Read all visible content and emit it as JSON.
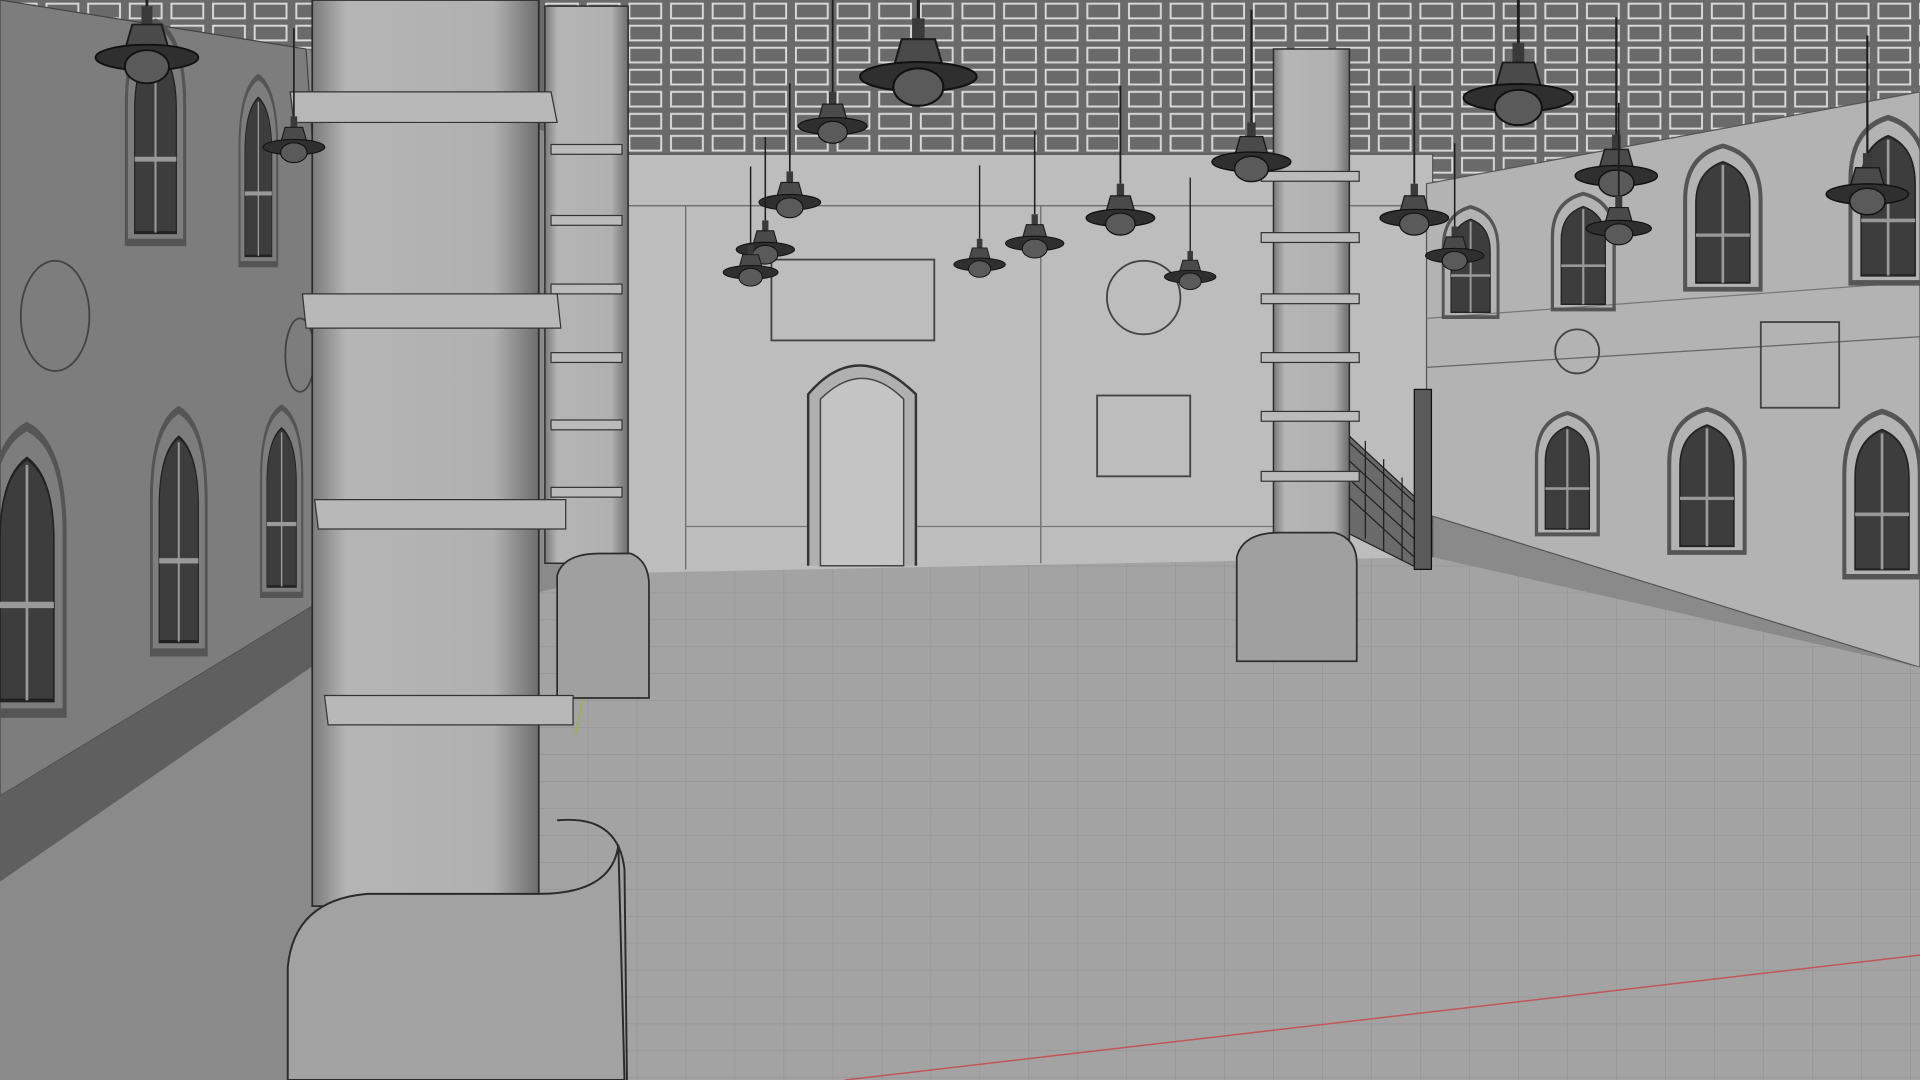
{
  "viewport": {
    "shading": "solid-wireframe-overlay",
    "colors": {
      "background": "#8a8a8a",
      "ceiling": "#707070",
      "ceiling_tile_line": "#d8d8d8",
      "back_wall": "#bdbdbd",
      "right_wall": "#b3b3b3",
      "left_wall": "#7d7d7d",
      "left_floor_strip": "#5f5f5f",
      "floor": "#a3a3a3",
      "floor_grid": "#8f8f8f",
      "column": "#a9a9a9",
      "column_edge": "#2b2b2b",
      "window_glass": "#3d3d3d",
      "lamp": "#2c2c2c",
      "x_axis": "#c45555",
      "y_axis": "#9bb34a"
    }
  },
  "scene": {
    "objects": [
      {
        "name": "ceiling",
        "icon": "ceiling-grid"
      },
      {
        "name": "floor",
        "icon": "floor-grid"
      },
      {
        "name": "back-wall",
        "icon": "wall"
      },
      {
        "name": "left-wall",
        "icon": "wall"
      },
      {
        "name": "right-wall",
        "icon": "wall"
      },
      {
        "name": "column-front-left",
        "icon": "column"
      },
      {
        "name": "column-back-left",
        "icon": "column"
      },
      {
        "name": "column-center-right",
        "icon": "column"
      },
      {
        "name": "staircase",
        "icon": "stairs"
      },
      {
        "name": "archway",
        "icon": "arch-doorway"
      },
      {
        "name": "pendant-lamps",
        "icon": "lamp"
      }
    ]
  }
}
